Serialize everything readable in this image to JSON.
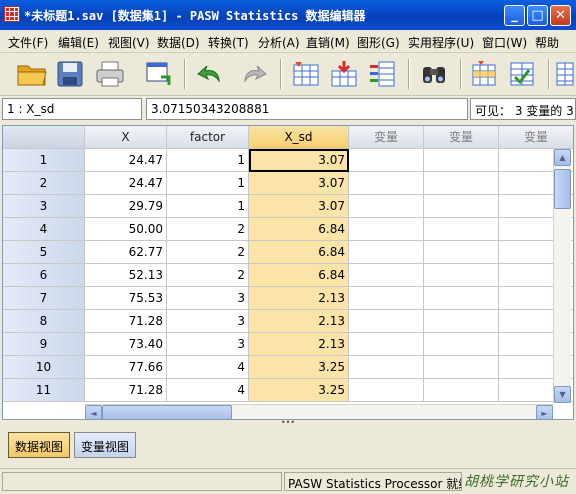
{
  "window": {
    "title": "*未标题1.sav [数据集1] - PASW Statistics 数据编辑器",
    "minimize_glyph": "_",
    "maximize_glyph": "□",
    "close_glyph": "✕"
  },
  "menu": [
    "文件(F)",
    "编辑(E)",
    "视图(V)",
    "数据(D)",
    "转换(T)",
    "分析(A)",
    "直销(M)",
    "图形(G)",
    "实用程序(U)",
    "窗口(W)",
    "帮助"
  ],
  "toolbar_icons": [
    "open-folder-icon",
    "save-icon",
    "print-icon",
    "dialog-recall-icon",
    "undo-icon",
    "redo-icon",
    "goto-case-icon",
    "goto-variable-icon",
    "variables-icon",
    "find-icon",
    "insert-cases-icon",
    "insert-variable-icon",
    "split-file-icon"
  ],
  "cell_bar": {
    "cell_ref": "1 : X_sd",
    "cell_value": "3.07150343208881",
    "visible_count": "可见： 3 变量的 3"
  },
  "grid": {
    "columns": [
      "X",
      "factor",
      "X_sd",
      "变量",
      "变量",
      "变量"
    ],
    "selected_column": 2,
    "rows": [
      {
        "num": "1",
        "cells": [
          "24.47",
          "1",
          "3.07"
        ]
      },
      {
        "num": "2",
        "cells": [
          "24.47",
          "1",
          "3.07"
        ]
      },
      {
        "num": "3",
        "cells": [
          "29.79",
          "1",
          "3.07"
        ]
      },
      {
        "num": "4",
        "cells": [
          "50.00",
          "2",
          "6.84"
        ]
      },
      {
        "num": "5",
        "cells": [
          "62.77",
          "2",
          "6.84"
        ]
      },
      {
        "num": "6",
        "cells": [
          "52.13",
          "2",
          "6.84"
        ]
      },
      {
        "num": "7",
        "cells": [
          "75.53",
          "3",
          "2.13"
        ]
      },
      {
        "num": "8",
        "cells": [
          "71.28",
          "3",
          "2.13"
        ]
      },
      {
        "num": "9",
        "cells": [
          "73.40",
          "3",
          "2.13"
        ]
      },
      {
        "num": "10",
        "cells": [
          "77.66",
          "4",
          "3.25"
        ]
      },
      {
        "num": "11",
        "cells": [
          "71.28",
          "4",
          "3.25"
        ]
      }
    ]
  },
  "scroll": {
    "up": "▲",
    "down": "▼",
    "left": "◄",
    "right": "►"
  },
  "splitter_glyph": "•••",
  "tabs": {
    "data_view": "数据视图",
    "variable_view": "变量视图"
  },
  "status": {
    "processor": "PASW Statistics Processor 就绪",
    "watermark": "胡桃学研究小站"
  },
  "colors": {
    "selected_column": "#fce4a8",
    "title_bar": "#0a5fe0"
  }
}
